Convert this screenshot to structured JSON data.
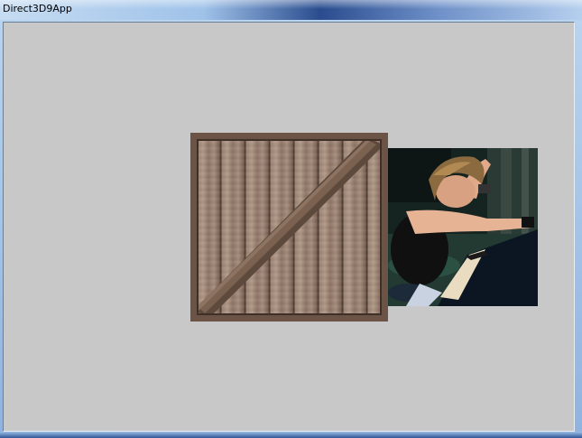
{
  "window": {
    "title": "Direct3D9App"
  },
  "scene": {
    "textures": [
      {
        "icon": "wooden-crate-texture"
      },
      {
        "icon": "pianist-photo-texture"
      }
    ],
    "background_color": "#c8c8c8"
  }
}
